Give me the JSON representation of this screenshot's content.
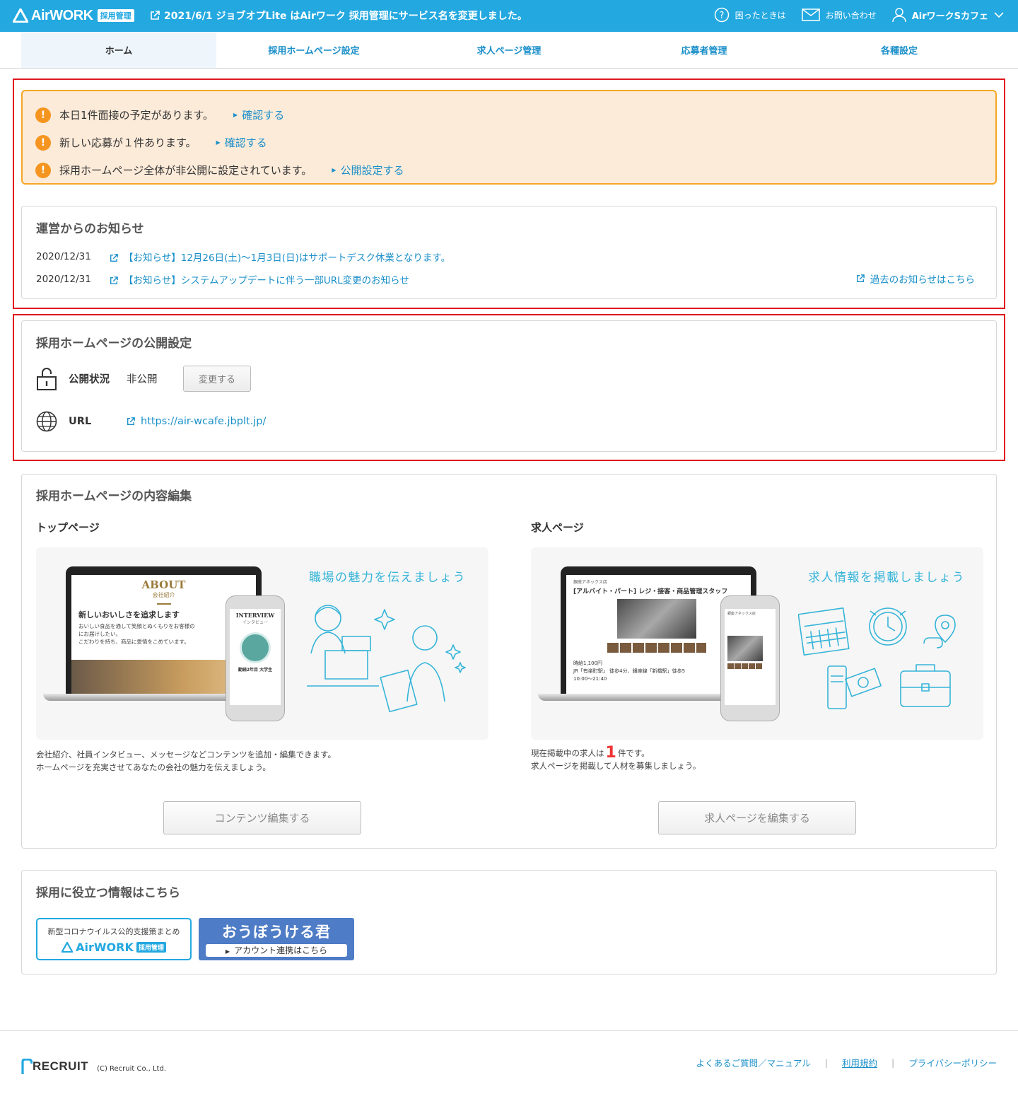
{
  "header": {
    "logo_text": "AirWORK",
    "logo_badge": "採用管理",
    "notice": "2021/6/1 ジョブオプLite はAirワーク 採用管理にサービス名を変更しました。",
    "help_label": "困ったときは",
    "contact_label": "お問い合わせ",
    "user_name": "AirワークSカフェ"
  },
  "nav": {
    "tabs": [
      {
        "label": "ホーム"
      },
      {
        "label": "採用ホームページ設定"
      },
      {
        "label": "求人ページ管理"
      },
      {
        "label": "応募者管理"
      },
      {
        "label": "各種設定"
      }
    ]
  },
  "alerts": [
    {
      "text": "本日1件面接の予定があります。",
      "link": "確認する"
    },
    {
      "text": "新しい応募が１件あります。",
      "link": "確認する"
    },
    {
      "text": "採用ホームページ全体が非公開に設定されています。",
      "link": "公開設定する"
    }
  ],
  "news": {
    "title": "運営からのお知らせ",
    "items": [
      {
        "date": "2020/12/31",
        "text": "【お知らせ】12月26日(土)～1月3日(日)はサポートデスク休業となります。"
      },
      {
        "date": "2020/12/31",
        "text": "【お知らせ】システムアップデートに伴う一部URL変更のお知らせ"
      }
    ],
    "past_link": "過去のお知らせはこちら"
  },
  "publish": {
    "title": "採用ホームページの公開設定",
    "status_label": "公開状況",
    "status_value": "非公開",
    "change_button": "変更する",
    "url_label": "URL",
    "url": "https://air-wcafe.jbplt.jp/"
  },
  "edit": {
    "title": "採用ホームページの内容編集",
    "top": {
      "subtitle": "トップページ",
      "caption": "職場の魅力を伝えましょう",
      "desc1": "会社紹介、社員インタビュー、メッセージなどコンテンツを追加・編集できます。",
      "desc2": "ホームページを充実させてあなたの会社の魅力を伝えましょう。",
      "button": "コンテンツ編集する",
      "mock_about": "ABOUT",
      "mock_about_sub": "会社紹介",
      "mock_heading": "新しいおいしさを追求します",
      "mock_body1": "おいしい食品を通して笑顔とぬくもりをお客様の",
      "mock_body2": "にお届けしたい。",
      "mock_body3": "こだわりを持ち、商品に愛情をこめています。",
      "mock_interview": "INTERVIEW",
      "mock_interview_sub": "インタビュー",
      "mock_person": "勤続2年目 大学生"
    },
    "job": {
      "subtitle": "求人ページ",
      "caption": "求人情報を掲載しましょう",
      "desc_pre": "現在掲載中の求人は",
      "count": "1",
      "desc_post": "件です。",
      "desc2": "求人ページを掲載して人材を募集しましょう。",
      "button": "求人ページを編集する",
      "mock_store": "銀座アネックス店",
      "mock_title": "[アルバイト・パート] レジ・接客・商品管理スタッフ",
      "mock_wage": "時給1,100円",
      "mock_access": "JR「有楽町駅」 徒歩4分、銀座線「新橋駅」徒歩5",
      "mock_hours": "10:00〜21:40"
    }
  },
  "useful": {
    "title": "採用に役立つ情報はこちら",
    "banner1_text": "新型コロナウイルス公的支援策まとめ",
    "banner1_logo": "AirWORK",
    "banner1_badge": "採用管理",
    "banner2_title": "おうぼうける君",
    "banner2_sub": "アカウント連携はこちら"
  },
  "footer": {
    "logo": "RECRUIT",
    "copyright": "(C) Recruit Co., Ltd.",
    "links": [
      "よくあるご質問／マニュアル",
      "利用規約",
      "プライバシーポリシー"
    ]
  },
  "colors": {
    "brand": "#23a8e0",
    "link": "#1a8fc9",
    "alert_bg": "#fdebd9",
    "alert_border": "#f5a623",
    "highlight_box": "#e0161d"
  }
}
